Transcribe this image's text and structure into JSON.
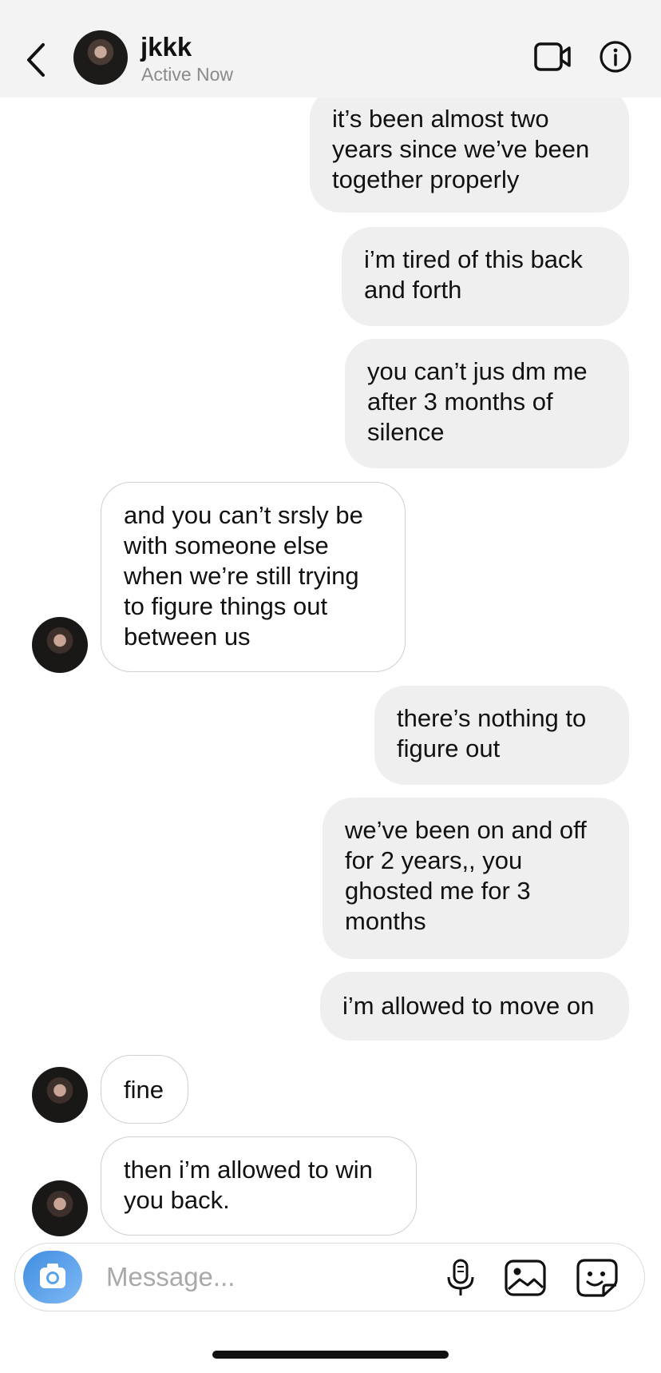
{
  "header": {
    "name": "jkkk",
    "status": "Active Now"
  },
  "icons": {
    "back": "back-chevron-icon",
    "video": "video-call-icon",
    "info": "info-icon",
    "camera": "camera-icon",
    "mic": "microphone-icon",
    "gallery": "gallery-icon",
    "sticker": "sticker-icon"
  },
  "messages": [
    {
      "from": "me",
      "text": "it’s been almost two\nyears since we’ve been\ntogether properly"
    },
    {
      "from": "me",
      "text": "i’m tired of this back\nand forth"
    },
    {
      "from": "me",
      "text": "you can’t jus dm me\nafter 3 months of\nsilence"
    },
    {
      "from": "them",
      "text": "and you can’t srsly be\nwith someone else\nwhen we’re still trying\nto figure things out\nbetween us"
    },
    {
      "from": "me",
      "text": "there’s nothing to\nfigure out"
    },
    {
      "from": "me",
      "text": "we’ve been on and off\nfor 2 years,, you\nghosted me for 3\nmonths"
    },
    {
      "from": "me",
      "text": "i’m allowed to move on"
    },
    {
      "from": "them",
      "text": "fine"
    },
    {
      "from": "them",
      "text": "then i’m allowed to win\nyou back."
    }
  ],
  "composer": {
    "placeholder": "Message..."
  },
  "colors": {
    "header_bg": "#f3f3f3",
    "sent_bubble": "#efefef",
    "received_border": "#cfcfcf",
    "camera_button": "#3f8de0"
  }
}
